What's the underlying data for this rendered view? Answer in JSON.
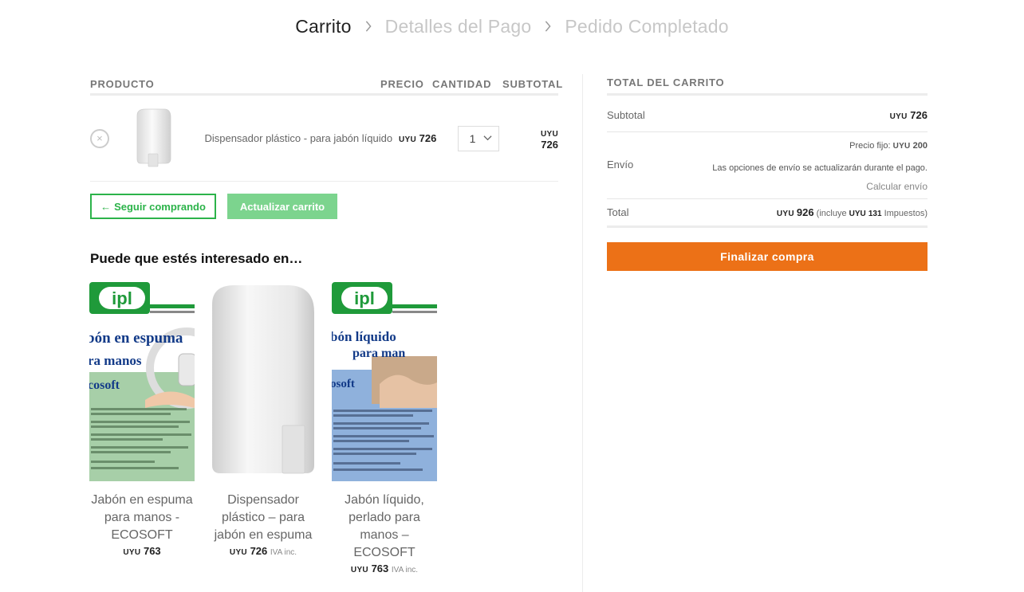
{
  "breadcrumb": {
    "steps": [
      "Carrito",
      "Detalles del Pago",
      "Pedido Completado"
    ]
  },
  "cart": {
    "headers": {
      "product": "PRODUCTO",
      "price": "PRECIO",
      "quantity": "CANTIDAD",
      "subtotal": "SUBTOTAL"
    },
    "items": [
      {
        "remove_symbol": "×",
        "name": "Dispensador plástico - para jabón líquido",
        "currency": "UYU",
        "price": "726",
        "quantity": "1",
        "subtotal": "726"
      }
    ],
    "continue_label": "Seguir comprando",
    "continue_arrow": "←",
    "update_label": "Actualizar carrito"
  },
  "related": {
    "title": "Puede que estés interesado en…",
    "products": [
      {
        "name": "Jabón en espuma para manos -ECOSOFT",
        "currency": "UYU",
        "price": "763",
        "note": "",
        "image": "ecosoft-foam-label"
      },
      {
        "name": "Dispensador plástico – para jabón en espuma",
        "currency": "UYU",
        "price": "726",
        "note": "IVA inc.",
        "image": "white-dispenser"
      },
      {
        "name": "Jabón líquido, perlado para manos – ECOSOFT",
        "currency": "UYU",
        "price": "763",
        "note": "IVA inc.",
        "image": "ecosoft-liquid-label"
      }
    ],
    "label_images": {
      "brand": "ipl",
      "foam_lines": [
        "bón en espuma",
        "ra manos",
        "cosoft"
      ],
      "liquid_lines": [
        "bón líquido",
        "para man",
        "osoft"
      ]
    }
  },
  "totals": {
    "title": "TOTAL DEL CARRITO",
    "subtotal_label": "Subtotal",
    "subtotal_currency": "UYU",
    "subtotal_value": "726",
    "shipping_label": "Envío",
    "shipping_fixed_label": "Precio fijo:",
    "shipping_currency": "UYU",
    "shipping_value": "200",
    "shipping_note": "Las opciones de envío se actualizarán durante el pago.",
    "calc_shipping": "Calcular envío",
    "total_label": "Total",
    "total_currency": "UYU",
    "total_value": "926",
    "includes_prefix": "(incluye",
    "tax_currency": "UYU",
    "tax_value": "131",
    "tax_suffix": "Impuestos)",
    "checkout_label": "Finalizar compra"
  },
  "colors": {
    "green": "#2cb34a",
    "green_light": "#7cd48e",
    "orange": "#ec7117",
    "ipl_green": "#1f9a3a"
  }
}
